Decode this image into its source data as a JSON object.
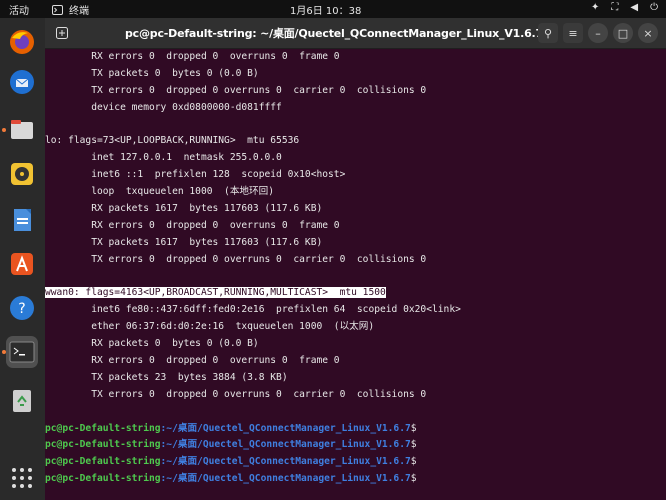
{
  "topbar": {
    "activities": "活动",
    "app_name": "终端",
    "clock": "1月6日  10：38"
  },
  "dock": {
    "items": [
      "firefox",
      "thunderbird",
      "files",
      "rhythmbox",
      "writer",
      "app-center",
      "help",
      "terminal",
      "trash",
      "show-apps"
    ]
  },
  "window": {
    "title": "pc@pc-Default-string: ~/桌面/Quectel_QConnectManager_Linux_V1.6.7"
  },
  "terminal": {
    "lines": [
      "        RX errors 0  dropped 0  overruns 0  frame 0",
      "        TX packets 0  bytes 0 (0.0 B)",
      "        TX errors 0  dropped 0 overruns 0  carrier 0  collisions 0",
      "        device memory 0xd0800000-d081ffff",
      "",
      "lo: flags=73<UP,LOOPBACK,RUNNING>  mtu 65536",
      "        inet 127.0.0.1  netmask 255.0.0.0",
      "        inet6 ::1  prefixlen 128  scopeid 0x10<host>",
      "        loop  txqueuelen 1000  (本地环回)",
      "        RX packets 1617  bytes 117603 (117.6 KB)",
      "        RX errors 0  dropped 0  overruns 0  frame 0",
      "        TX packets 1617  bytes 117603 (117.6 KB)",
      "        TX errors 0  dropped 0 overruns 0  carrier 0  collisions 0",
      "",
      "wwan0: flags=4163<UP,BROADCAST,RUNNING,MULTICAST>  mtu 1500",
      "        inet6 fe80::437:6dff:fed0:2e16  prefixlen 64  scopeid 0x20<link>",
      "        ether 06:37:6d:d0:2e:16  txqueuelen 1000  (以太网)",
      "        RX packets 0  bytes 0 (0.0 B)",
      "        RX errors 0  dropped 0  overruns 0  frame 0",
      "        TX packets 23  bytes 3884 (3.8 KB)",
      "        TX errors 0  dropped 0 overruns 0  carrier 0  collisions 0",
      ""
    ],
    "prompt_user": "pc@pc-Default-string",
    "prompt_path": ":~/桌面/Quectel_QConnectManager_Linux_V1.6.7",
    "prompt_symbol": "$",
    "prompt_count": 4
  }
}
